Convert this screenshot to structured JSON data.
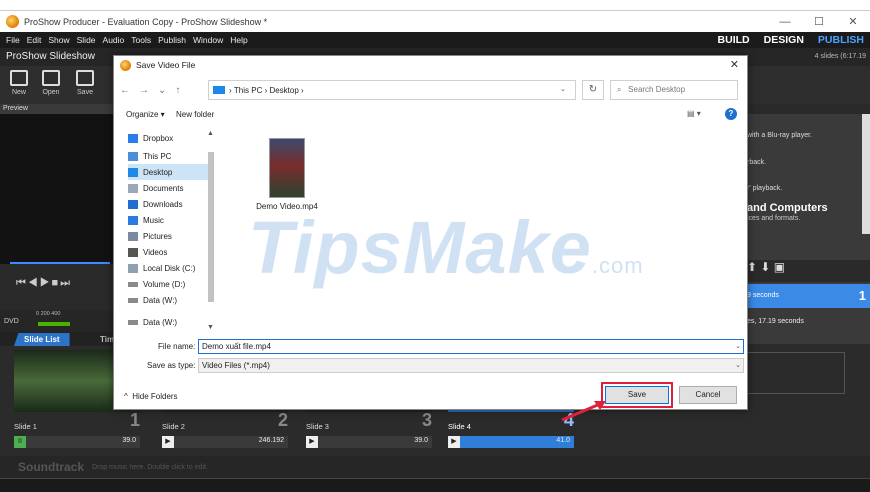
{
  "window": {
    "title": "ProShow Producer - Evaluation Copy - ProShow Slideshow *",
    "controls": [
      "—",
      "☐",
      "✕"
    ]
  },
  "menu": [
    "File",
    "Edit",
    "Show",
    "Slide",
    "Audio",
    "Tools",
    "Publish",
    "Window",
    "Help"
  ],
  "modes": {
    "build": "BUILD",
    "design": "DESIGN",
    "publish": "PUBLISH"
  },
  "show": {
    "name": "ProShow Slideshow",
    "info": "4 slides (6:17.19"
  },
  "toolbar": {
    "new": "New",
    "open": "Open",
    "save": "Save"
  },
  "preview_label": "Preview",
  "dvd": {
    "label": "DVD",
    "ticks": "0     200    400"
  },
  "tabs": {
    "slide_list": "Slide List",
    "timeline": "Tim"
  },
  "slides": [
    {
      "label": "Slide 1",
      "num": "1",
      "dur": "39.0"
    },
    {
      "label": "Slide 2",
      "num": "2",
      "dur": "246.192"
    },
    {
      "label": "Slide 3",
      "num": "3",
      "dur": "39.0"
    },
    {
      "label": "Slide 4",
      "num": "4",
      "dur": "41.0"
    }
  ],
  "soundtrack": {
    "title": "Soundtrack",
    "hint": "Drop music here.  Double click to edit."
  },
  "right_panel": {
    "line1": "with a Blu-ray player.",
    "line2": "rback.",
    "line3": "r' playback.",
    "big": "and Computers",
    "sub": "ices and formats.",
    "seconds": "9 seconds",
    "badge": "1",
    "footer": "es, 17.19 seconds"
  },
  "watermark": {
    "main": "TipsMake",
    "suffix": ".com"
  },
  "dialog": {
    "title": "Save Video File",
    "close": "✕",
    "path_this_pc": "This PC",
    "path_desktop": "Desktop",
    "search_placeholder": "Search Desktop",
    "organize": "Organize ▾",
    "new_folder": "New folder",
    "nav_items": [
      "Dropbox",
      "This PC",
      "Desktop",
      "Documents",
      "Downloads",
      "Music",
      "Pictures",
      "Videos",
      "Local Disk (C:)",
      "Volume (D:)",
      "Data (W:)",
      "Data (W:)"
    ],
    "file": {
      "name": "Demo Video.mp4"
    },
    "file_name_label": "File name:",
    "file_name_value": "Demo xuất file.mp4",
    "save_type_label": "Save as type:",
    "save_type_value": "Video Files (*.mp4)",
    "hide_folders": "Hide Folders",
    "save": "Save",
    "cancel": "Cancel"
  },
  "colors": {
    "accent": "#2f7fd8",
    "publish": "#4aa3ff",
    "highlight": "#e0203a"
  }
}
